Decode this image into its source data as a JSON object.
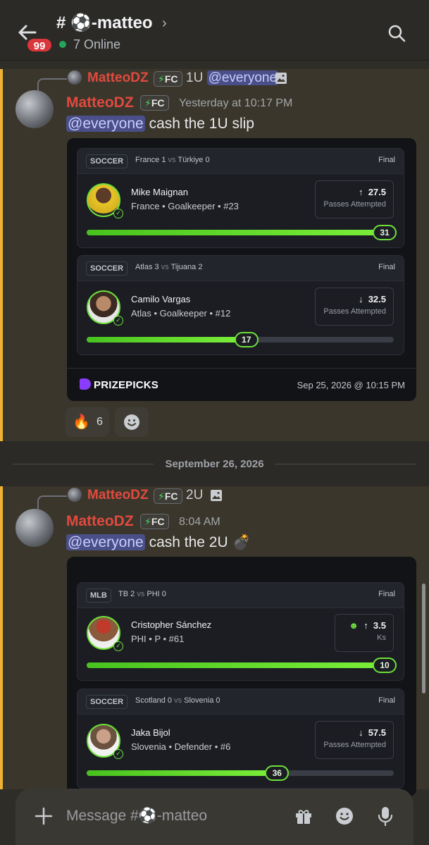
{
  "header": {
    "back_icon": "arrow-left-icon",
    "unread_badge": "99",
    "channel_prefix": "#",
    "channel_emoji": "⚽",
    "channel_name": "-matteo",
    "online": "7 Online",
    "search_icon": "search-icon"
  },
  "messages": [
    {
      "reply": {
        "name": "MatteoDZ",
        "tag": "FC",
        "text_prefix": "1U",
        "mention": "@everyone"
      },
      "author": "MatteoDZ",
      "tag": "FC",
      "timestamp": "Yesterday at 10:17 PM",
      "mention": "@everyone",
      "text": "cash the 1U slip",
      "embed": {
        "picks": [
          {
            "sport": "SOCCER",
            "team1": "France",
            "score1": "1",
            "vs": "vs",
            "team2": "Türkiye",
            "score2": "0",
            "status": "Final",
            "player": "Mike Maignan",
            "meta": "France • Goalkeeper • #23",
            "direction": "↑",
            "line": "27.5",
            "stat": "Passes Attempted",
            "result": "31",
            "progress": 1.0
          },
          {
            "sport": "SOCCER",
            "team1": "Atlas",
            "score1": "3",
            "vs": "vs",
            "team2": "Tijuana",
            "score2": "2",
            "status": "Final",
            "player": "Camilo Vargas",
            "meta": "Atlas • Goalkeeper • #12",
            "direction": "↓",
            "line": "32.5",
            "stat": "Passes Attempted",
            "result": "17",
            "progress": 0.52
          }
        ],
        "brand": "PRIZEPICKS",
        "date": "Sep 25, 2026 @ 10:15 PM"
      },
      "reactions": [
        {
          "emoji": "🔥",
          "count": "6"
        }
      ]
    },
    {
      "reply": {
        "name": "MatteoDZ",
        "tag": "FC",
        "text_prefix": "2U"
      },
      "author": "MatteoDZ",
      "tag": "FC",
      "timestamp": "8:04 AM",
      "mention": "@everyone",
      "text": "cash the 2U",
      "text_emoji": "💣",
      "embed": {
        "picks": [
          {
            "sport": "MLB",
            "team1": "TB",
            "score1": "2",
            "vs": "vs",
            "team2": "PHI",
            "score2": "0",
            "status": "Final",
            "player": "Cristopher Sánchez",
            "meta": "PHI • P • #61",
            "direction": "↑",
            "line": "3.5",
            "stat": "Ks",
            "result": "10",
            "progress": 1.0
          },
          {
            "sport": "SOCCER",
            "team1": "Scotland",
            "score1": "0",
            "vs": "vs",
            "team2": "Slovenia",
            "score2": "0",
            "status": "Final",
            "player": "Jaka Bijol",
            "meta": "Slovenia • Defender • #6",
            "direction": "↓",
            "line": "57.5",
            "stat": "Passes Attempted",
            "result": "36",
            "progress": 0.62
          }
        ]
      }
    }
  ],
  "divider": "September 26, 2026",
  "composer": {
    "placeholder_prefix": "Message #",
    "placeholder_emoji": "⚽",
    "placeholder_suffix": "-matteo"
  },
  "colors": {
    "accent_green": "#6fe03a",
    "mention_bg": "#4a4f8a",
    "author_red": "#e04a3f",
    "highlight_border": "#f0b232"
  }
}
